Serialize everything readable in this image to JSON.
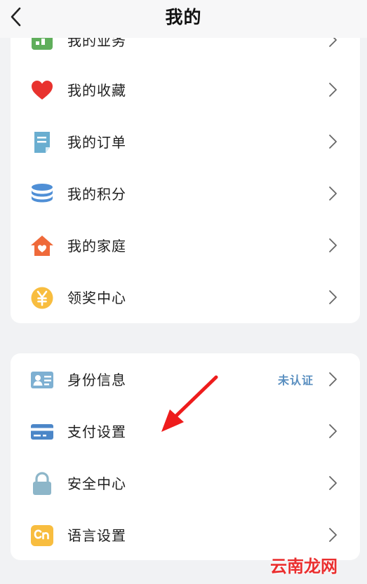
{
  "header": {
    "title": "我的",
    "back_icon": "chevron-left-icon"
  },
  "group1": {
    "items": [
      {
        "label": "我的业务",
        "icon": "business-icon",
        "color": "#5fae5b"
      },
      {
        "label": "我的收藏",
        "icon": "heart-icon",
        "color": "#e8322e"
      },
      {
        "label": "我的订单",
        "icon": "order-document-icon",
        "color": "#6aaed0"
      },
      {
        "label": "我的积分",
        "icon": "points-stack-icon",
        "color": "#4f8fd6"
      },
      {
        "label": "我的家庭",
        "icon": "family-home-icon",
        "color": "#ef6a3a"
      },
      {
        "label": "领奖中心",
        "icon": "yuan-coin-icon",
        "color": "#f8bd3f"
      }
    ]
  },
  "group2": {
    "items": [
      {
        "label": "身份信息",
        "icon": "id-card-icon",
        "status": "未认证",
        "color": "#7eb0d2"
      },
      {
        "label": "支付设置",
        "icon": "payment-card-icon",
        "color": "#4b86c8"
      },
      {
        "label": "安全中心",
        "icon": "lock-icon",
        "color": "#8db6c9"
      },
      {
        "label": "语言设置",
        "icon": "language-cn-icon",
        "color": "#f8bd3f"
      }
    ]
  },
  "watermark": {
    "text": "云南龙网"
  },
  "colors": {
    "background": "#f1f2f4",
    "card": "#ffffff",
    "status": "#5a8fc0",
    "arrow": "#ee1c1c"
  }
}
